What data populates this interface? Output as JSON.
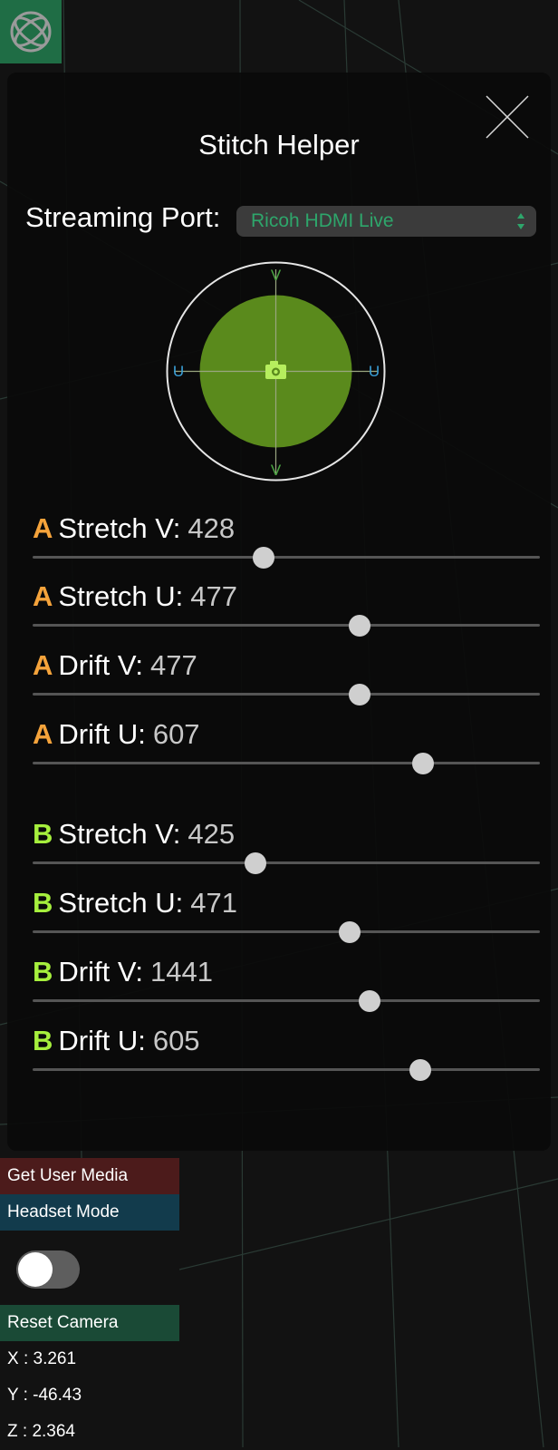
{
  "panel": {
    "title": "Stitch Helper",
    "port_label": "Streaming Port:",
    "port_value": "Ricoh HDMI Live"
  },
  "joystick": {
    "top_label": "V",
    "bottom_label": "V",
    "left_label": "U",
    "right_label": "U",
    "center_icon": "camera-icon"
  },
  "sliders": [
    {
      "channel": "A",
      "name": "Stretch V:",
      "value": "428",
      "fraction": 0.455
    },
    {
      "channel": "A",
      "name": "Stretch U:",
      "value": "477",
      "fraction": 0.645
    },
    {
      "channel": "A",
      "name": "Drift V:",
      "value": "477",
      "fraction": 0.645
    },
    {
      "channel": "A",
      "name": "Drift U:",
      "value": "607",
      "fraction": 0.77
    },
    {
      "channel": "B",
      "name": "Stretch V:",
      "value": "425",
      "fraction": 0.44
    },
    {
      "channel": "B",
      "name": "Stretch U:",
      "value": "471",
      "fraction": 0.625
    },
    {
      "channel": "B",
      "name": "Drift V:",
      "value": "1441",
      "fraction": 0.665
    },
    {
      "channel": "B",
      "name": "Drift U:",
      "value": "605",
      "fraction": 0.765
    }
  ],
  "sidebar": {
    "get_user_media": "Get User Media",
    "headset_mode": "Headset Mode",
    "headset_enabled": false,
    "reset_camera": "Reset Camera",
    "x": "X : 3.261",
    "y": "Y : -46.43",
    "z": "Z : 2.364"
  },
  "colors": {
    "channel_a": "#f5a33b",
    "channel_b": "#a6ef3d",
    "joystick_fill": "#5a8a1c",
    "port_text": "#2ea66b"
  }
}
